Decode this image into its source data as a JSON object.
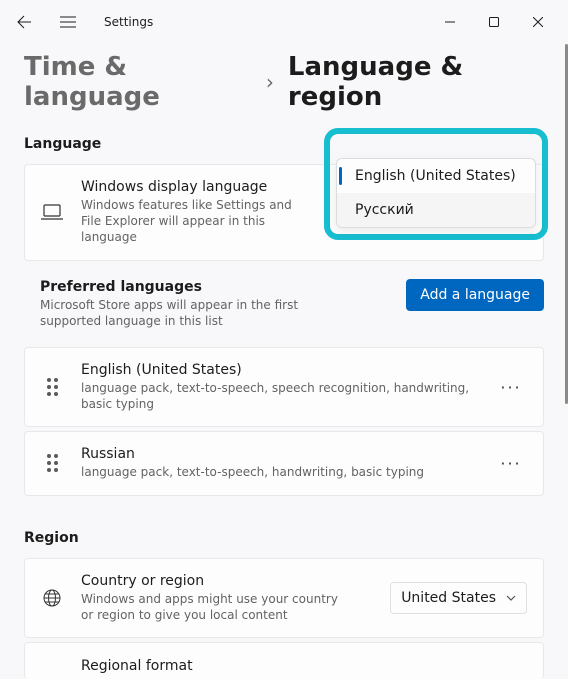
{
  "app_title": "Settings",
  "breadcrumb": {
    "parent": "Time & language",
    "current": "Language & region"
  },
  "sections": {
    "language": "Language",
    "region": "Region"
  },
  "display_lang": {
    "title": "Windows display language",
    "sub": "Windows features like Settings and File Explorer will appear in this language"
  },
  "dropdown": {
    "option1": "English (United States)",
    "option2": "Русский"
  },
  "preferred": {
    "title": "Preferred languages",
    "sub": "Microsoft Store apps will appear in the first supported language in this list",
    "add_button": "Add a language"
  },
  "lang_items": [
    {
      "name": "English (United States)",
      "sub": "language pack, text-to-speech, speech recognition, handwriting, basic typing"
    },
    {
      "name": "Russian",
      "sub": "language pack, text-to-speech, handwriting, basic typing"
    }
  ],
  "country": {
    "title": "Country or region",
    "sub": "Windows and apps might use your country or region to give you local content",
    "value": "United States"
  },
  "regional_format": {
    "title": "Regional format"
  }
}
